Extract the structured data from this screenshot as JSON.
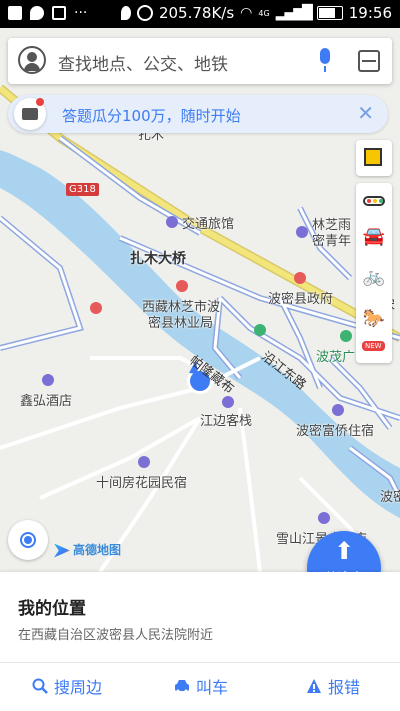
{
  "status_bar": {
    "net_speed": "205.78K/s",
    "network": "4G",
    "time": "19:56"
  },
  "search": {
    "placeholder": "查找地点、公交、地铁"
  },
  "banner": {
    "text": "答题瓜分100万，随时开始"
  },
  "map": {
    "road_shield": "G318",
    "labels": {
      "zhamu_partial": "扎木",
      "jiaotong_hotel": "交通旅馆",
      "linzhi_partial": "林芝雨",
      "miyu_partial": "密青年",
      "zhamu_bridge": "扎木大桥",
      "forestry_1": "西藏林芝市波",
      "forestry_2": "密县林业局",
      "county_gov": "波密县政府",
      "palong": "帕隆藏布",
      "yanjiang": "沿江东路",
      "bomao": "波茂广",
      "xinhong": "鑫弘酒店",
      "jiangbian": "江边客栈",
      "bomi_fuqiao": "波密富侨住宿",
      "shijian": "十间房花园民宿",
      "bomi_edge": "波密",
      "xueshan": "雪山江景大酒店",
      "song_partial": "宋"
    },
    "logo": "高德地图",
    "colors": {
      "river": "#a9d3ee",
      "road_main": "#f2e57a",
      "road_outline": "#8ea7e0",
      "accent": "#3d7cf4"
    }
  },
  "side_tools": {
    "new_badge": "NEW"
  },
  "goto_button": {
    "label": "从这走"
  },
  "panel": {
    "title": "我的位置",
    "address": "在西藏自治区波密县人民法院附近",
    "actions": [
      {
        "label": "搜周边",
        "icon": "search-icon"
      },
      {
        "label": "叫车",
        "icon": "car-icon"
      },
      {
        "label": "报错",
        "icon": "warning-icon"
      }
    ]
  }
}
